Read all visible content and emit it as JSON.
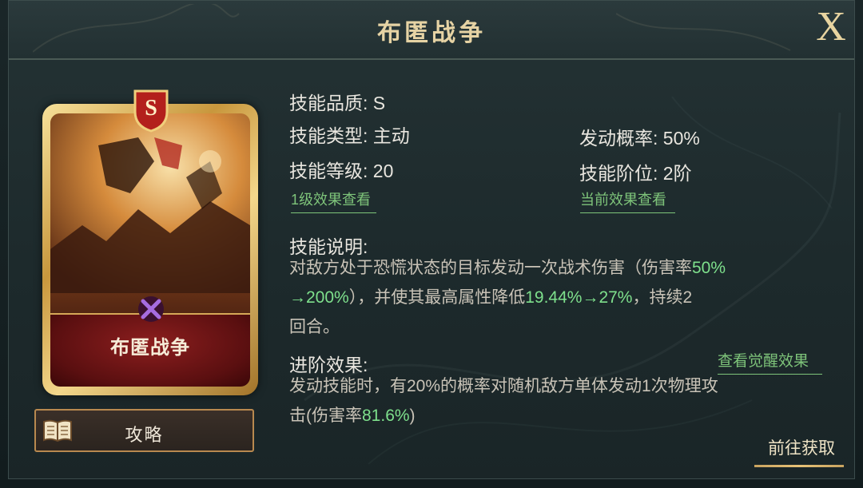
{
  "window": {
    "title": "布匿战争"
  },
  "card": {
    "rarity": "S",
    "name": "布匿战争"
  },
  "guide_button": {
    "label": "攻略"
  },
  "info": {
    "quality": "技能品质: S",
    "type": "技能类型: 主动",
    "trigger_rate": "发动概率: 50%",
    "level": "技能等级: 20",
    "rank": "技能阶位: 2阶",
    "level1_link": "1级效果查看",
    "current_link": "当前效果查看"
  },
  "description": {
    "heading": "技能说明:",
    "line1_a": "对敌方处于恐慌状态的目标发动一次战术伤害（伤害率",
    "line1_b": "50%",
    "line2_a": "→200%",
    "line2_b": "），并使其最高属性降低",
    "line2_c": "19.44%→27%",
    "line2_d": "，持续2",
    "line3": "回合。"
  },
  "advance": {
    "heading": "进阶效果:",
    "awaken_link": "查看觉醒效果",
    "line1": "发动技能时，有20%的概率对随机敌方单体发动1次物理攻",
    "line2_a": "击(伤害率",
    "line2_b": "81.6%",
    "line2_c": ")"
  },
  "goto_button": {
    "label": "前往获取"
  },
  "colors": {
    "title_gold": "#e6d3a4",
    "highlight_green": "#7ee08c",
    "link_green": "#7ec47a",
    "card_red": "#8c1e1e"
  }
}
